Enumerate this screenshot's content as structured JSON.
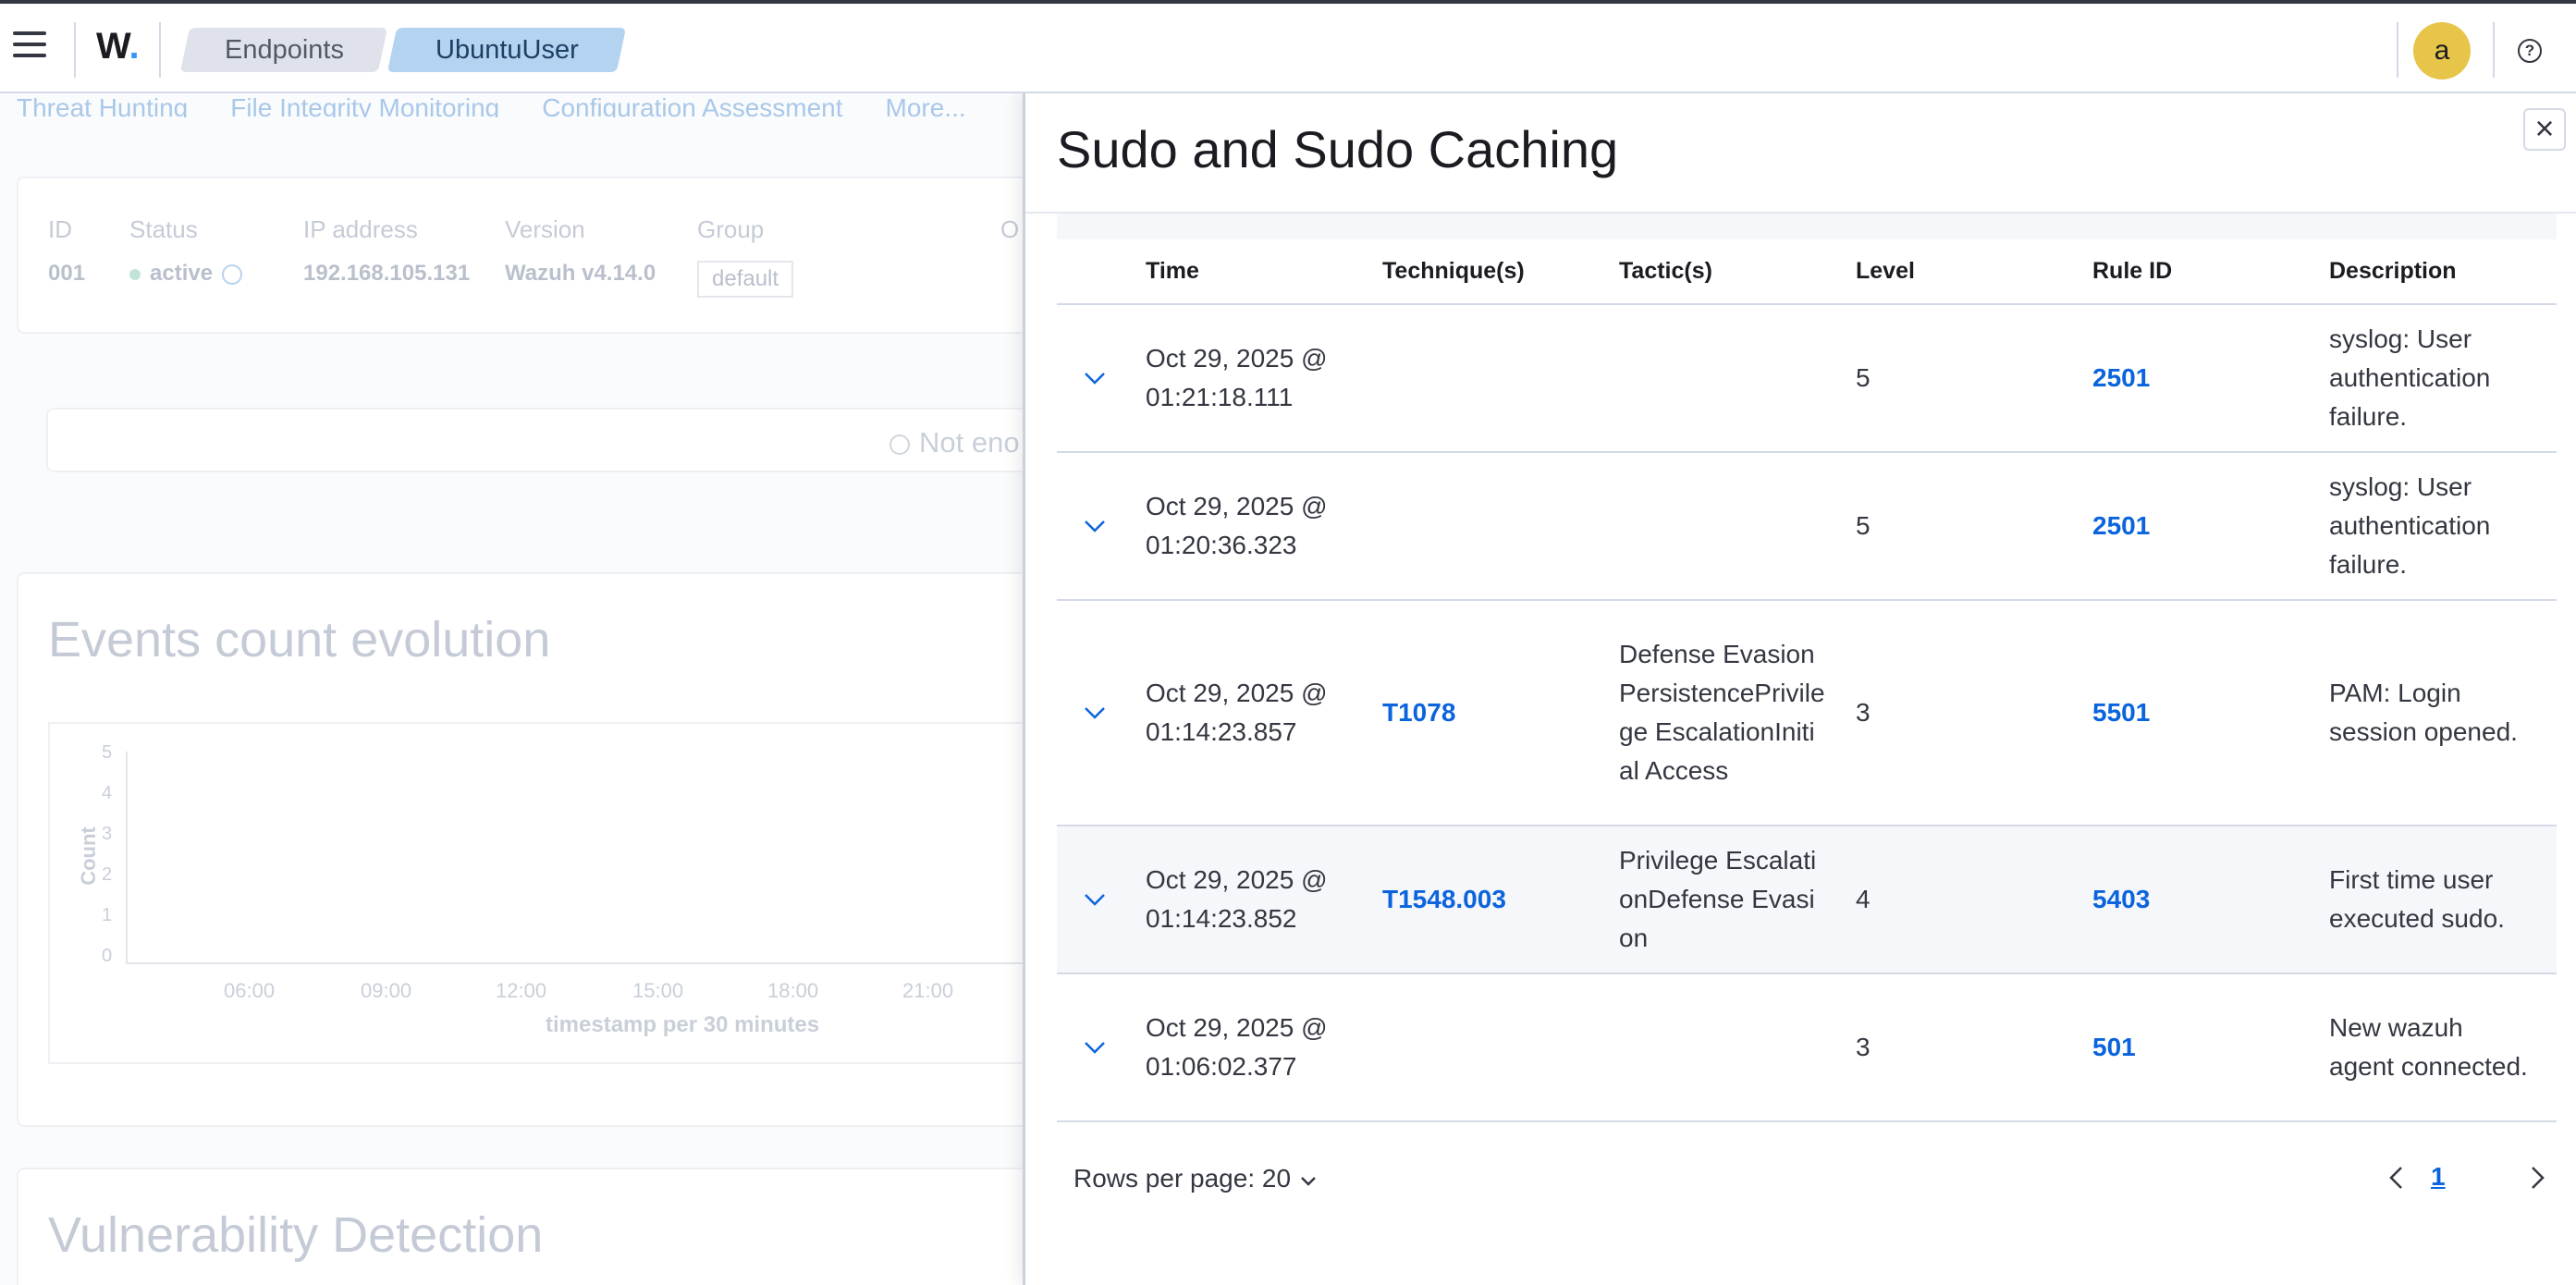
{
  "header": {
    "logo": "W",
    "breadcrumbs": [
      "Endpoints",
      "UbuntuUser"
    ],
    "avatar_initial": "a",
    "help_glyph": "?"
  },
  "background": {
    "tabs": [
      "Threat Hunting",
      "File Integrity Monitoring",
      "Configuration Assessment",
      "More..."
    ],
    "agent": {
      "labels": [
        "ID",
        "Status",
        "IP address",
        "Version",
        "Group",
        "O"
      ],
      "id": "001",
      "status": "active",
      "ip": "192.168.105.131",
      "version": "Wazuh v4.14.0",
      "group": "default"
    },
    "not_enough": "Not eno",
    "events_title": "Events count evolution",
    "chart": {
      "y_label": "Count",
      "y_ticks": [
        "5",
        "4",
        "3",
        "2",
        "1",
        "0"
      ],
      "x_ticks": [
        "06:00",
        "09:00",
        "12:00",
        "15:00",
        "18:00",
        "21:00"
      ],
      "x_label": "timestamp per 30 minutes"
    },
    "vuln_title": "Vulnerability Detection"
  },
  "flyout": {
    "title": "Sudo and Sudo Caching",
    "close_glyph": "×",
    "columns": [
      "Time",
      "Technique(s)",
      "Tactic(s)",
      "Level",
      "Rule ID",
      "Description"
    ],
    "rows": [
      {
        "time": "Oct 29, 2025 @ 01:21:18.111",
        "technique": "",
        "tactic": "",
        "level": "5",
        "rule_id": "2501",
        "description": "syslog: User authentication failure."
      },
      {
        "time": "Oct 29, 2025 @ 01:20:36.323",
        "technique": "",
        "tactic": "",
        "level": "5",
        "rule_id": "2501",
        "description": "syslog: User authentication failure."
      },
      {
        "time": "Oct 29, 2025 @ 01:14:23.857",
        "technique": "T1078",
        "tactic": "Defense EvasionPersistencePrivilege EscalationInitial Access",
        "level": "3",
        "rule_id": "5501",
        "description": "PAM: Login session opened."
      },
      {
        "time": "Oct 29, 2025 @ 01:14:23.852",
        "technique": "T1548.003",
        "tactic": "Privilege EscalationDefense Evasion",
        "level": "4",
        "rule_id": "5403",
        "description": "First time user executed sudo."
      },
      {
        "time": "Oct 29, 2025 @ 01:06:02.377",
        "technique": "",
        "tactic": "",
        "level": "3",
        "rule_id": "501",
        "description": "New wazuh agent connected."
      }
    ],
    "rows_per_page": "Rows per page: 20",
    "current_page": "1"
  }
}
